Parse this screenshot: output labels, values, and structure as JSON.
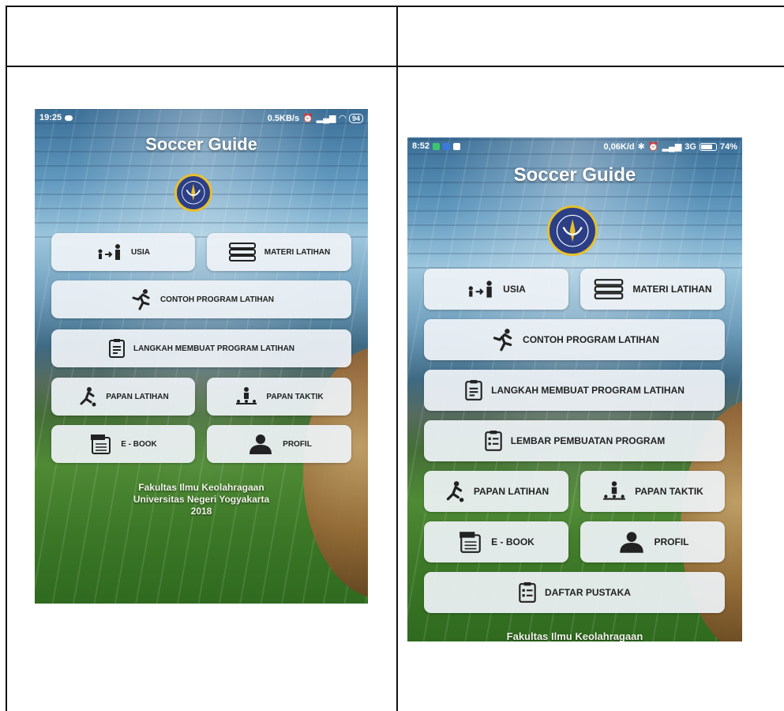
{
  "phone1": {
    "status": {
      "time": "19:25",
      "net": "0.5KB/s",
      "battery": "94"
    },
    "title": "Soccer Guide",
    "buttons": {
      "usia": "USIA",
      "materi": "MATERI LATIHAN",
      "contoh": "CONTOH PROGRAM LATIHAN",
      "langkah": "LANGKAH MEMBUAT PROGRAM LATIHAN",
      "papan_latihan": "PAPAN LATIHAN",
      "papan_taktik": "PAPAN TAKTIK",
      "ebook": "E - BOOK",
      "profil": "PROFIL"
    },
    "footer": {
      "line1": "Fakultas Ilmu Keolahragaan",
      "line2": "Universitas Negeri Yogyakarta",
      "line3": "2018"
    }
  },
  "phone2": {
    "status": {
      "time": "8:52",
      "net": "0,06K/d",
      "network": "3G",
      "battery": "74%"
    },
    "title": "Soccer Guide",
    "buttons": {
      "usia": "USIA",
      "materi": "MATERI LATIHAN",
      "contoh": "CONTOH PROGRAM LATIHAN",
      "langkah": "LANGKAH MEMBUAT PROGRAM LATIHAN",
      "lembar": "LEMBAR PEMBUATAN PROGRAM",
      "papan_latihan": "PAPAN LATIHAN",
      "papan_taktik": "PAPAN TAKTIK",
      "ebook": "E - BOOK",
      "profil": "PROFIL",
      "daftar": "DAFTAR PUSTAKA"
    },
    "footer": {
      "line1": "Fakultas Ilmu Keolahragaan"
    }
  },
  "icons": [
    "age-progression-icon",
    "books-icon",
    "runner-icon",
    "clipboard-list-icon",
    "footballer-kick-icon",
    "tactic-board-icon",
    "ebook-icon",
    "person-silhouette-icon",
    "checklist-icon"
  ],
  "colors": {
    "button_bg": "#eef2f6",
    "logo_blue": "#2c3f86",
    "logo_gold": "#e8c02d"
  }
}
